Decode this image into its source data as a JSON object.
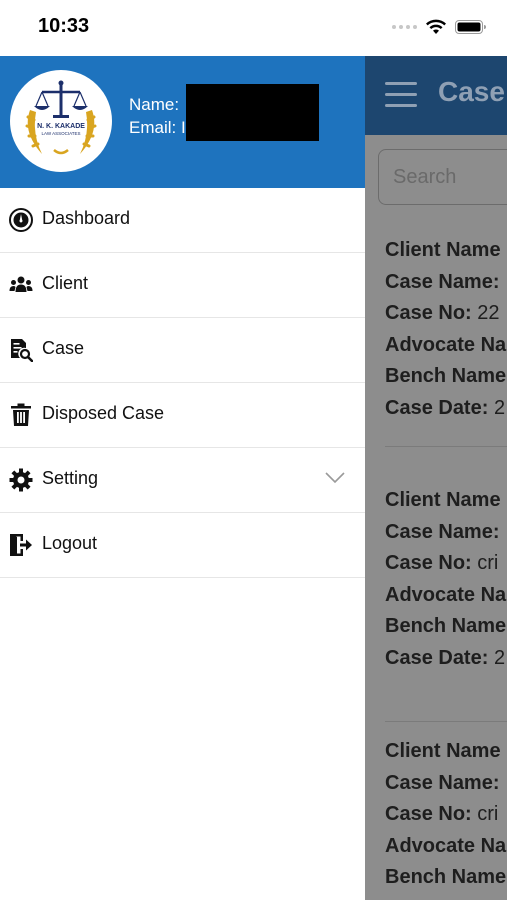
{
  "status_bar": {
    "time": "10:33"
  },
  "drawer": {
    "logo": {
      "line1": "N. K. KAKADE",
      "line2": "LAW ASSOCIATES"
    },
    "name_label": "Name:",
    "email_label": "Email: I",
    "menu": [
      {
        "label": "Dashboard",
        "icon": "dashboard-icon"
      },
      {
        "label": "Client",
        "icon": "users-icon"
      },
      {
        "label": "Case",
        "icon": "case-file-icon"
      },
      {
        "label": "Disposed Case",
        "icon": "trash-icon"
      },
      {
        "label": "Setting",
        "icon": "gear-icon"
      },
      {
        "label": "Logout",
        "icon": "logout-icon"
      }
    ]
  },
  "main": {
    "title": "Case",
    "search_placeholder": "Search",
    "cards": [
      {
        "client": "Client Name",
        "case_name": "Case Name:",
        "case_no_label": "Case No:",
        "case_no_value": " 22",
        "advocate": "Advocate Na",
        "bench": "Bench Name",
        "case_date_label": "Case Date:",
        "case_date_value": " 2"
      },
      {
        "client": "Client Name",
        "case_name": "Case Name:",
        "case_no_label": "Case No:",
        "case_no_value": " cri",
        "advocate": "Advocate Na",
        "bench": "Bench Name",
        "case_date_label": "Case Date:",
        "case_date_value": " 2"
      },
      {
        "client": "Client Name",
        "case_name": "Case Name:",
        "case_no_label": "Case No:",
        "case_no_value": " cri",
        "advocate": "Advocate Na",
        "bench": "Bench Name"
      }
    ]
  },
  "colors": {
    "drawer_header": "#1e73be",
    "main_header_dim": "#1d466f",
    "overlay_bg": "#8d8d8d",
    "logo_gold": "#d9a520",
    "logo_navy": "#1c2f6b"
  }
}
